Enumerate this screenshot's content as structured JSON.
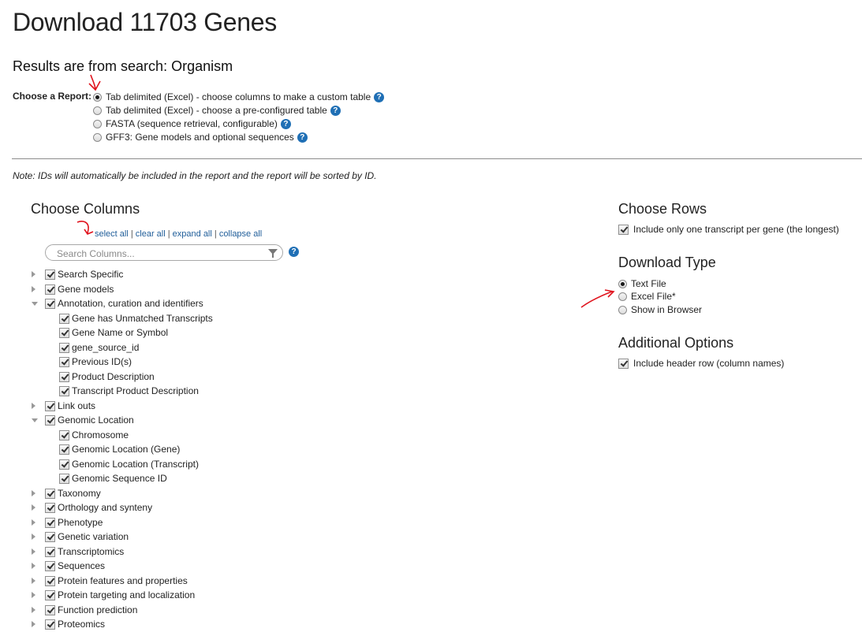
{
  "page": {
    "title": "Download 11703 Genes",
    "subtitle": "Results are from search: Organism"
  },
  "report": {
    "label": "Choose a Report:",
    "options": [
      {
        "label": "Tab delimited (Excel) - choose columns to make a custom table",
        "selected": true
      },
      {
        "label": "Tab delimited (Excel) - choose a pre-configured table",
        "selected": false
      },
      {
        "label": "FASTA (sequence retrieval, configurable)",
        "selected": false
      },
      {
        "label": "GFF3: Gene models and optional sequences",
        "selected": false
      }
    ],
    "help_glyph": "?"
  },
  "note": "Note: IDs will automatically be included in the report and the report will be sorted by ID.",
  "columns": {
    "heading": "Choose Columns",
    "links": {
      "select_all": "select all",
      "clear_all": "clear all",
      "expand_all": "expand all",
      "collapse_all": "collapse all",
      "separator": "|"
    },
    "search_placeholder": "Search Columns...",
    "tree": [
      {
        "label": "Search Specific",
        "level": 0,
        "expandable": true,
        "expanded": false,
        "checked": true
      },
      {
        "label": "Gene models",
        "level": 0,
        "expandable": true,
        "expanded": false,
        "checked": true
      },
      {
        "label": "Annotation, curation and identifiers",
        "level": 0,
        "expandable": true,
        "expanded": true,
        "checked": true
      },
      {
        "label": "Gene has Unmatched Transcripts",
        "level": 1,
        "expandable": false,
        "checked": true
      },
      {
        "label": "Gene Name or Symbol",
        "level": 1,
        "expandable": false,
        "checked": true
      },
      {
        "label": "gene_source_id",
        "level": 1,
        "expandable": false,
        "checked": true
      },
      {
        "label": "Previous ID(s)",
        "level": 1,
        "expandable": false,
        "checked": true
      },
      {
        "label": "Product Description",
        "level": 1,
        "expandable": false,
        "checked": true
      },
      {
        "label": "Transcript Product Description",
        "level": 1,
        "expandable": false,
        "checked": true
      },
      {
        "label": "Link outs",
        "level": 0,
        "expandable": true,
        "expanded": false,
        "checked": true
      },
      {
        "label": "Genomic Location",
        "level": 0,
        "expandable": true,
        "expanded": true,
        "checked": true
      },
      {
        "label": "Chromosome",
        "level": 1,
        "expandable": false,
        "checked": true
      },
      {
        "label": "Genomic Location (Gene)",
        "level": 1,
        "expandable": false,
        "checked": true
      },
      {
        "label": "Genomic Location (Transcript)",
        "level": 1,
        "expandable": false,
        "checked": true
      },
      {
        "label": "Genomic Sequence ID",
        "level": 1,
        "expandable": false,
        "checked": true
      },
      {
        "label": "Taxonomy",
        "level": 0,
        "expandable": true,
        "expanded": false,
        "checked": true
      },
      {
        "label": "Orthology and synteny",
        "level": 0,
        "expandable": true,
        "expanded": false,
        "checked": true
      },
      {
        "label": "Phenotype",
        "level": 0,
        "expandable": true,
        "expanded": false,
        "checked": true
      },
      {
        "label": "Genetic variation",
        "level": 0,
        "expandable": true,
        "expanded": false,
        "checked": true
      },
      {
        "label": "Transcriptomics",
        "level": 0,
        "expandable": true,
        "expanded": false,
        "checked": true
      },
      {
        "label": "Sequences",
        "level": 0,
        "expandable": true,
        "expanded": false,
        "checked": true
      },
      {
        "label": "Protein features and properties",
        "level": 0,
        "expandable": true,
        "expanded": false,
        "checked": true
      },
      {
        "label": "Protein targeting and localization",
        "level": 0,
        "expandable": true,
        "expanded": false,
        "checked": true
      },
      {
        "label": "Function prediction",
        "level": 0,
        "expandable": true,
        "expanded": false,
        "checked": true
      },
      {
        "label": "Proteomics",
        "level": 0,
        "expandable": true,
        "expanded": false,
        "checked": true
      }
    ]
  },
  "rows": {
    "heading": "Choose Rows",
    "one_transcript_label": "Include only one transcript per gene (the longest)",
    "one_transcript_checked": true
  },
  "download_type": {
    "heading": "Download Type",
    "options": [
      {
        "label": "Text File",
        "selected": true
      },
      {
        "label": "Excel File*",
        "selected": false
      },
      {
        "label": "Show in Browser",
        "selected": false
      }
    ]
  },
  "additional": {
    "heading": "Additional Options",
    "header_row_label": "Include header row (column names)",
    "header_row_checked": true
  },
  "colors": {
    "link": "#1f5d99",
    "help_icon": "#1f6fb5",
    "annotation": "#e0141e"
  }
}
